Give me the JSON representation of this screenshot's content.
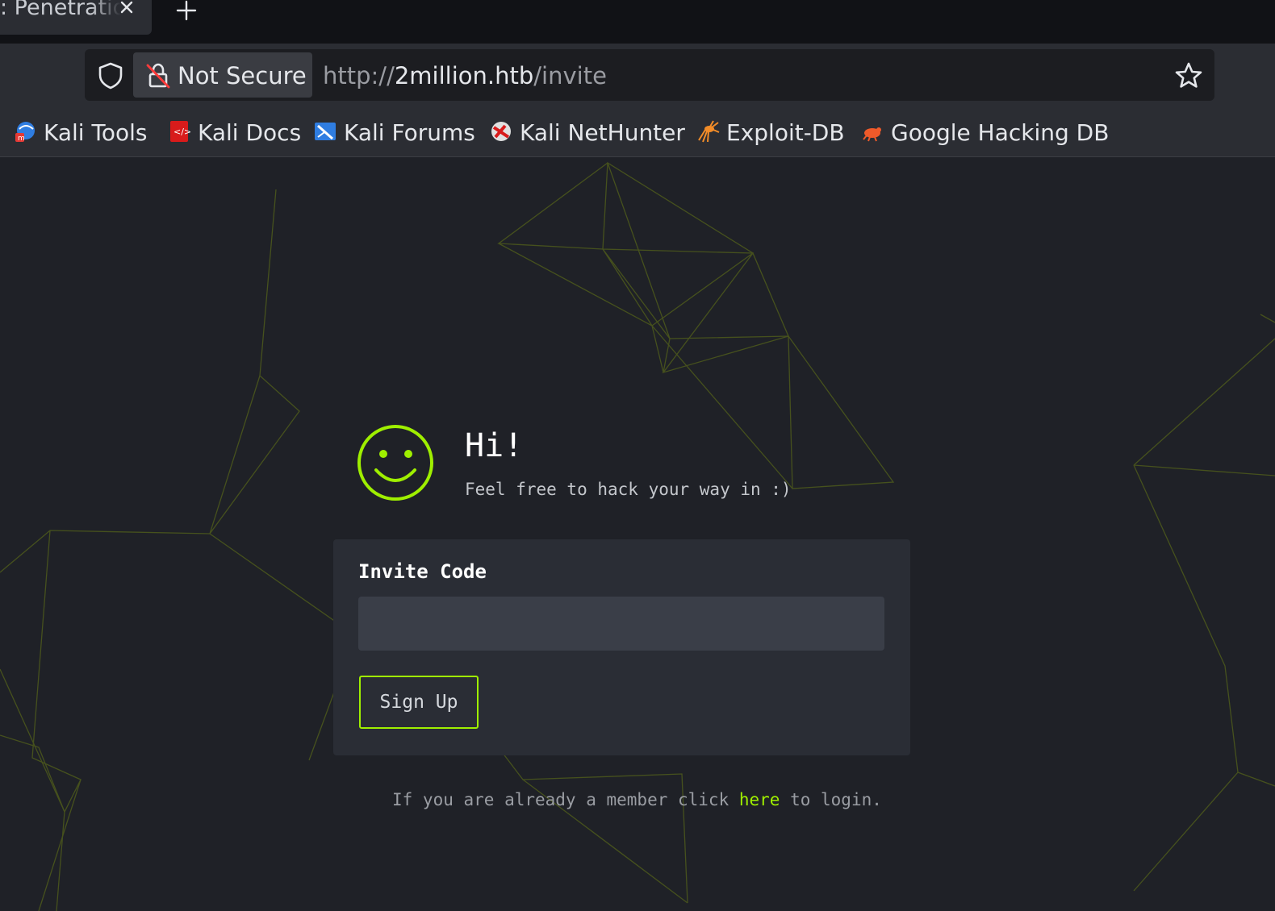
{
  "browser": {
    "tab_title": ": Penetratio",
    "address": {
      "security_label": "Not Secure",
      "url_scheme": "http://",
      "url_host": "2million.htb",
      "url_path": "/invite"
    },
    "bookmarks": [
      {
        "label": "Kali Tools",
        "icon": "kali-tools-icon"
      },
      {
        "label": "Kali Docs",
        "icon": "kali-docs-icon"
      },
      {
        "label": "Kali Forums",
        "icon": "kali-forums-icon"
      },
      {
        "label": "Kali NetHunter",
        "icon": "kali-nethunter-icon"
      },
      {
        "label": "Exploit-DB",
        "icon": "exploit-db-icon"
      },
      {
        "label": "Google Hacking DB",
        "icon": "google-hacking-db-icon"
      }
    ]
  },
  "page": {
    "greeting": "Hi!",
    "subtitle": "Feel free to hack your way in :)",
    "form": {
      "label": "Invite Code",
      "input_value": "",
      "button_label": "Sign Up"
    },
    "footer": {
      "prefix": "If you are already a member click ",
      "link": "here",
      "suffix": " to login."
    }
  },
  "colors": {
    "accent": "#9fef00",
    "background": "#1f2127",
    "card": "#2a2d35",
    "input": "#3a3e48"
  }
}
